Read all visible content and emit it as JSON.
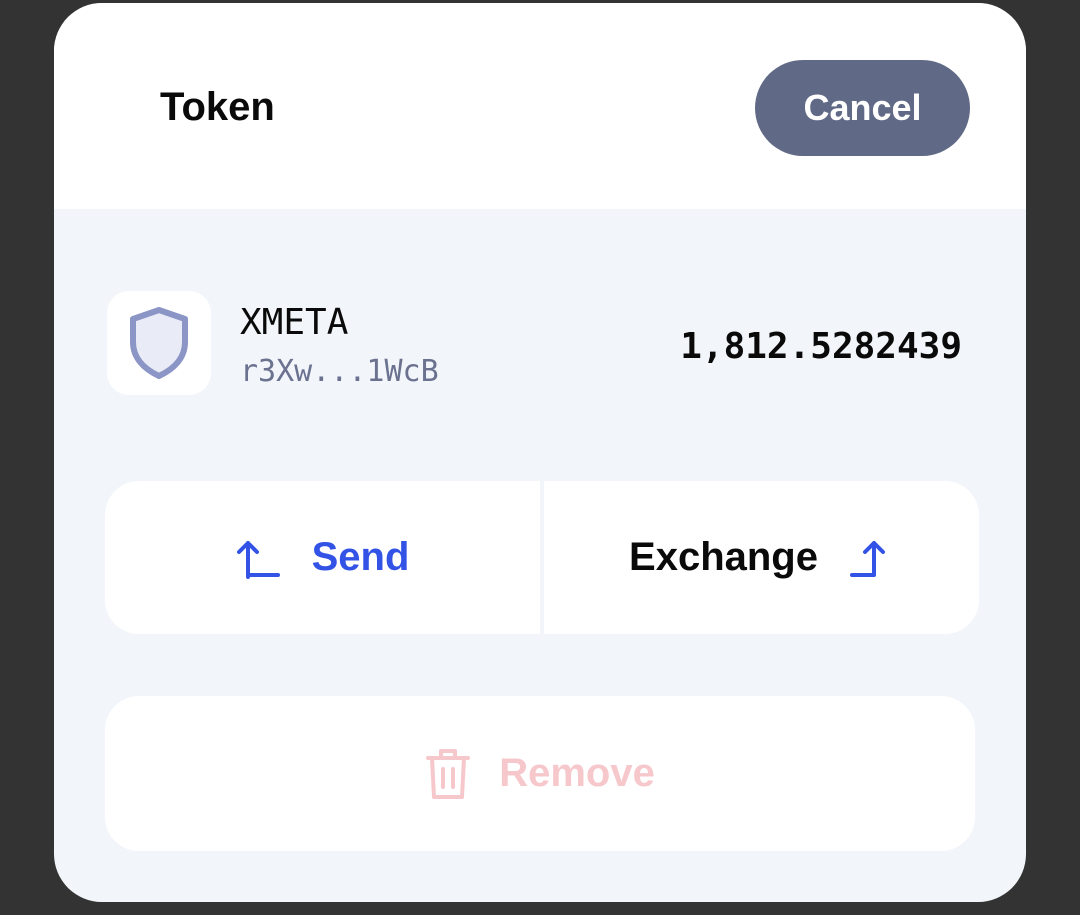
{
  "header": {
    "title": "Token",
    "cancel_label": "Cancel"
  },
  "token": {
    "icon": "shield-icon",
    "symbol": "XMETA",
    "address": "r3Xw...1WcB",
    "balance": "1,812.5282439"
  },
  "actions": {
    "send_label": "Send",
    "send_icon": "arrow-up-left-icon",
    "exchange_label": "Exchange",
    "exchange_icon": "arrow-up-right-icon"
  },
  "remove": {
    "label": "Remove",
    "icon": "trash-icon"
  },
  "colors": {
    "accent": "#3253e6",
    "cancel_bg": "#606986",
    "remove_disabled": "#f6c8cc",
    "panel_bg": "#f2f5f9"
  }
}
